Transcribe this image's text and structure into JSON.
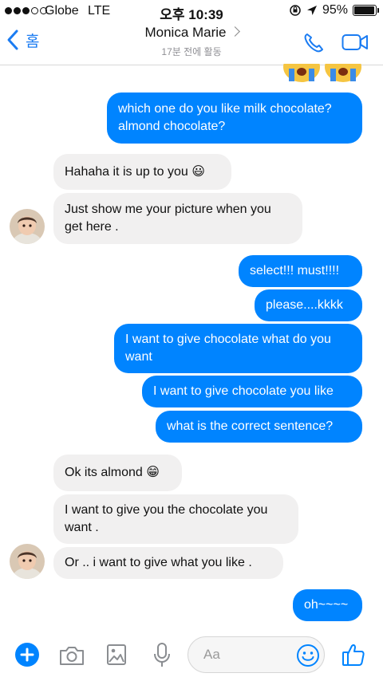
{
  "status_bar": {
    "carrier": "Globe",
    "network": "LTE",
    "time": "오후 10:39",
    "battery_percent": "95%",
    "battery_level": 0.95
  },
  "nav": {
    "back_label": "홈",
    "contact_name": "Monica Marie",
    "active_status": "17분 전에 활동",
    "icons": [
      "back-chevron-icon",
      "phone-icon",
      "video-icon"
    ]
  },
  "messages": [
    {
      "direction": "out",
      "text": "which one do you like milk chocolate?",
      "text2": "almond chocolate?"
    },
    {
      "direction": "in",
      "text": "Hahaha it is up to you 😃"
    },
    {
      "direction": "in",
      "text": "Just show me your picture when you",
      "text2": "get here ."
    },
    {
      "direction": "out",
      "text": "select!!! must!!!!"
    },
    {
      "direction": "out",
      "text": "please....kkkk"
    },
    {
      "direction": "out",
      "text": "I want to give chocolate what do you",
      "text2": "want"
    },
    {
      "direction": "out",
      "text": "I want to give chocolate you like"
    },
    {
      "direction": "out",
      "text": "what is the correct sentence?"
    },
    {
      "direction": "in",
      "text": "Ok its almond 😁"
    },
    {
      "direction": "in",
      "text": "I want to give you the chocolate you",
      "text2": "want ."
    },
    {
      "direction": "in",
      "text": "Or ..  i want to give what you like ."
    },
    {
      "direction": "out",
      "text": "oh~~~~"
    }
  ],
  "composer": {
    "placeholder": "Aa",
    "icons": [
      "plus-icon",
      "camera-icon",
      "image-icon",
      "microphone-icon",
      "emoji-icon",
      "thumbs-up-icon"
    ]
  },
  "colors": {
    "accent": "#0084ff",
    "nav_blue": "#1b7cf2",
    "incoming_bg": "#f1f0f0"
  }
}
